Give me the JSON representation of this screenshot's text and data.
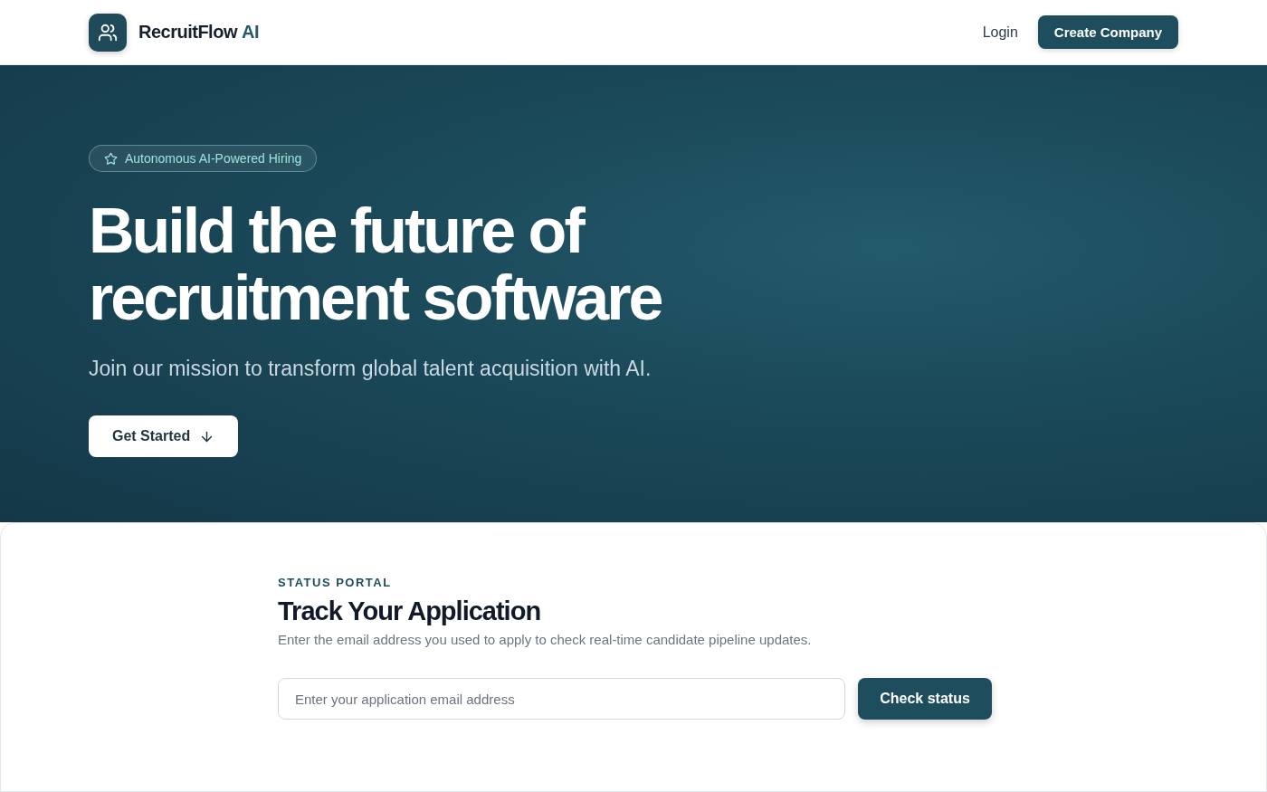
{
  "header": {
    "brand": {
      "name": "RecruitFlow",
      "suffix": "AI"
    },
    "login": "Login",
    "cta": "Create Company"
  },
  "hero": {
    "badge": "Autonomous AI-Powered Hiring",
    "headline": [
      "Build the future of",
      "recruitment software"
    ],
    "subtitle": "Join our mission to transform global talent acquisition with AI.",
    "button": "Get Started"
  },
  "status": {
    "eyebrow": "STATUS PORTAL",
    "title": "Track Your Application",
    "description": "Enter the email address you used to apply to check real-time candidate pipeline updates.",
    "placeholder": "Enter your application email address",
    "button": "Check status"
  }
}
